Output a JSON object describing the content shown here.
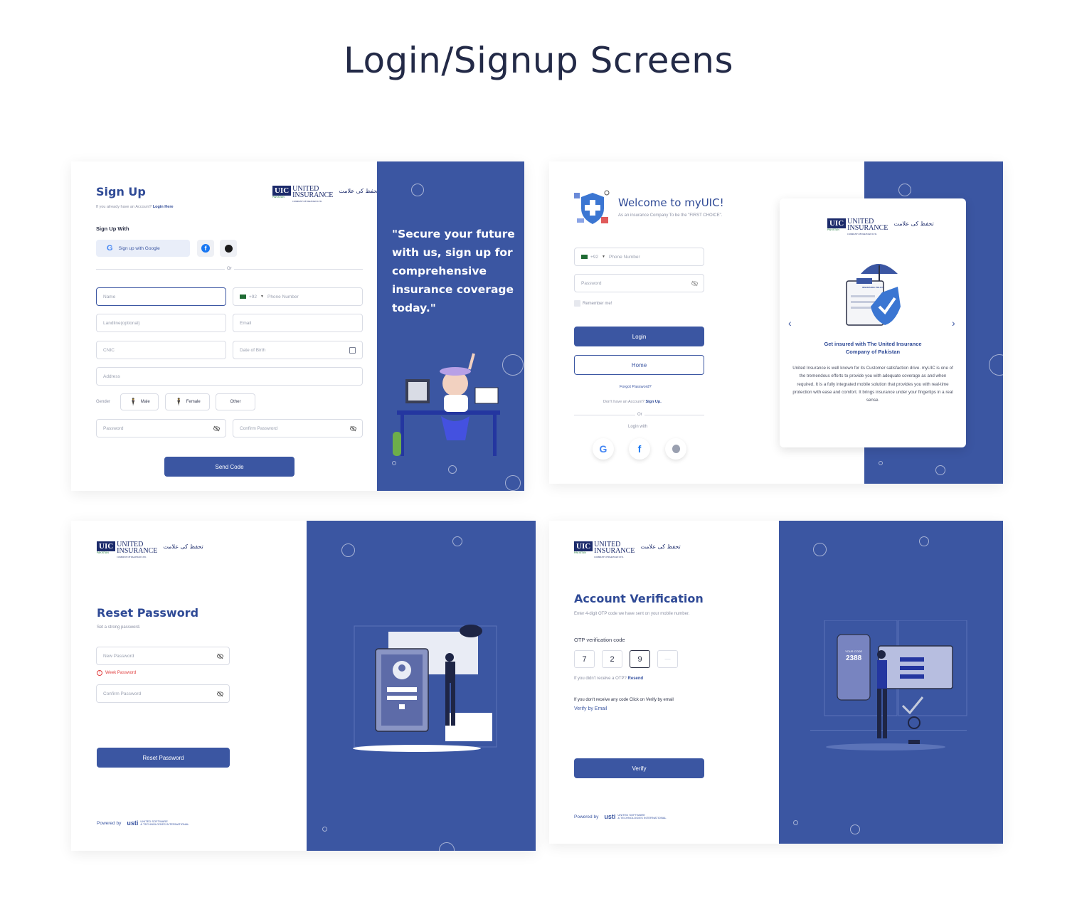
{
  "title": "Login/Signup Screens",
  "logo": {
    "box": "UIC",
    "name1": "UNITED",
    "name2": "INSURANCE",
    "sub": "PAKISTAN",
    "sub2": "COMPANY OF PAKISTAN LTD.",
    "urdu": "تحفظ کی علامت"
  },
  "signup": {
    "heading": "Sign Up",
    "have_account": "If you already have an Account?",
    "login_here": "Login Here",
    "sign_up_with": "Sign Up With",
    "google_btn": "Sign up with Google",
    "or": "Or",
    "name_ph": "Name",
    "phone_code": "+92",
    "phone_ph": "Phone Number",
    "landline_ph": "Landline(optional)",
    "email_ph": "Email",
    "cnic_ph": "CNIC",
    "dob_ph": "Date of Birth",
    "address_ph": "Address",
    "gender_label": "Gender",
    "male": "Male",
    "female": "Female",
    "other": "Other",
    "password_ph": "Password",
    "confirm_ph": "Confirm Password",
    "send_code": "Send Code",
    "quote": "\"Secure your future with us, sign up for comprehensive insurance coverage today.\""
  },
  "login": {
    "heading": "Welcome to myUIC!",
    "subtitle": "As an insurance Company To be the \"FIRST CHOICE\".",
    "phone_code": "+92",
    "phone_ph": "Phone Number",
    "password_ph": "Password",
    "remember": "Remember me!",
    "login_btn": "Login",
    "home_btn": "Home",
    "forgot": "Forgot Password?",
    "no_account": "Don't have an Account?",
    "sign_up": "Sign Up.",
    "or": "Or",
    "login_with": "Login with",
    "policy_label": "INSURANCE POLICY",
    "carousel_title": "Get insured with The United Insurance Company of Pakistan",
    "carousel_body": "United Insurance is well known for its Customer satisfaction drive. myUIC is one of the tremendous efforts to provide you with adequate coverage as and when required. It is a fully integrated mobile solution that provides you with real-time protection with ease and comfort.  It brings insurance under your fingertips in a real sense."
  },
  "reset": {
    "heading": "Reset Password",
    "subtitle": "Set a strong password.",
    "new_ph": "New Password",
    "weak": "Week Password",
    "confirm_ph": "Confirm Password",
    "btn": "Reset Password",
    "powered_by": "Powered by"
  },
  "verify": {
    "heading": "Account Verification",
    "subtitle": "Enter 4-digit OTP code we have sent on your mobile number.",
    "otp_label": "OTP verification code",
    "otp": [
      "7",
      "2",
      "9",
      "—"
    ],
    "didnt_receive": "If you didn't receive a OTP?",
    "resend": "Resend",
    "email_note": "If you don't receive any code Click on Verify by email",
    "verify_email": "Verify by Email",
    "btn": "Verify",
    "powered_by": "Powered by",
    "your_code": "YOUR CODE",
    "code": "2388"
  },
  "footer_brand": {
    "mark": "usti",
    "line1": "UNITED SOFTWARE",
    "line2": "& TECHNOLOGIES INTERNATIONAL"
  },
  "colors": {
    "brand_blue": "#3b56a2",
    "dark_navy": "#1c2b6b",
    "danger": "#e03b3b"
  }
}
